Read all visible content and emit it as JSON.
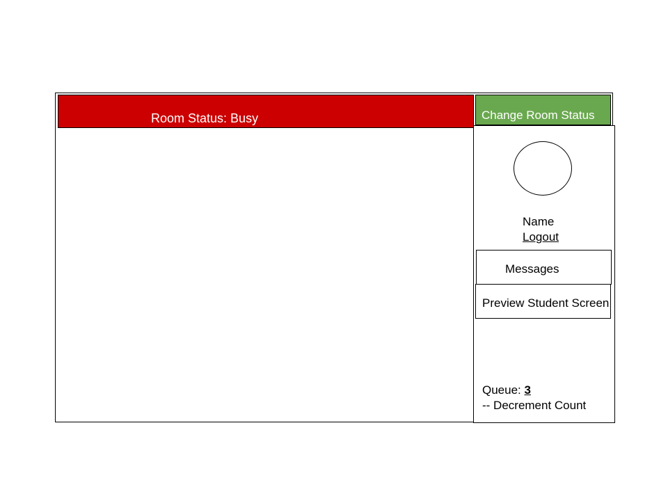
{
  "room_status": {
    "label": "Room Status: Busy",
    "color": "#cc0000"
  },
  "change_status_button": {
    "label": "Change Room Status",
    "color": "#6aa84f"
  },
  "profile": {
    "name": "Name",
    "logout_label": "Logout"
  },
  "sidebar": {
    "messages_label": "Messages",
    "preview_label": "Preview Student Screen"
  },
  "queue": {
    "label": "Queue: ",
    "count": "3",
    "decrement_label": "-- Decrement Count"
  }
}
